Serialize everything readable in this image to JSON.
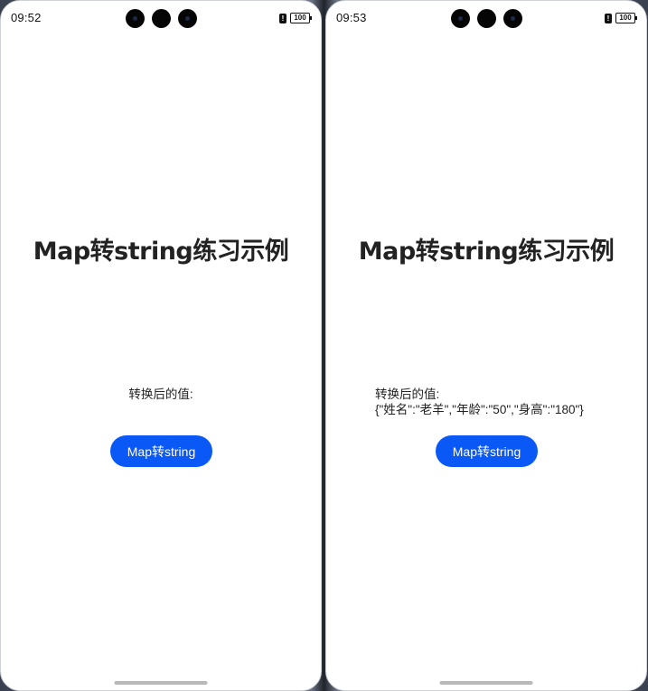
{
  "screens": [
    {
      "status_time": "09:52",
      "battery": "100",
      "title": "Map转string练习示例",
      "result_label": "转换后的值:",
      "result_value": "",
      "button_label": "Map转string"
    },
    {
      "status_time": "09:53",
      "battery": "100",
      "title": "Map转string练习示例",
      "result_label": "转换后的值:",
      "result_value": "{\"姓名\":\"老羊\",\"年龄\":\"50\",\"身高\":\"180\"}",
      "button_label": "Map转string"
    }
  ],
  "colors": {
    "accent": "#0a59f7",
    "title": "#222222",
    "background": "#ffffff"
  },
  "icons": [
    "camera-icon",
    "alert-icon",
    "battery-icon"
  ]
}
